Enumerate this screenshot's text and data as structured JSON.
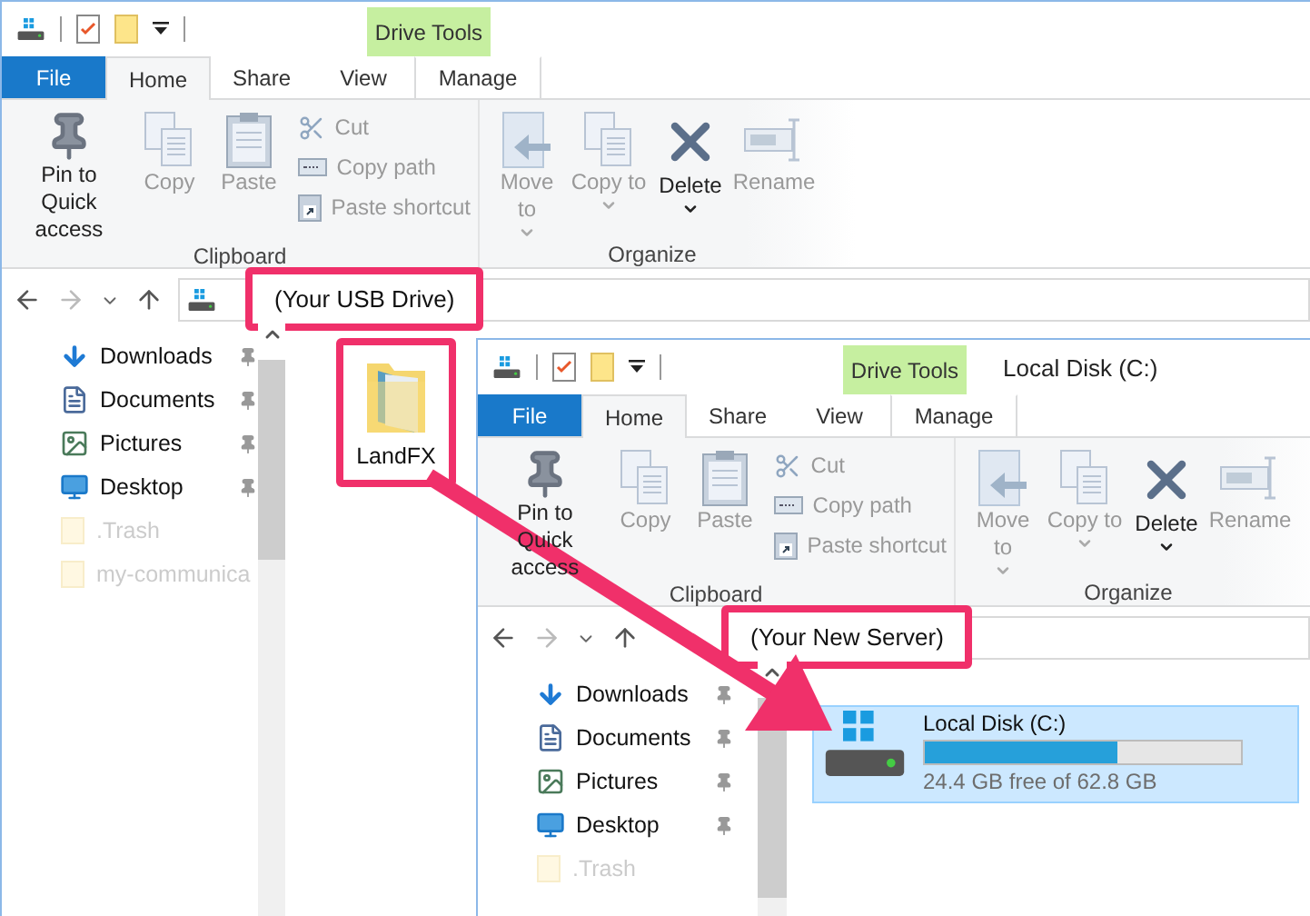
{
  "windows": [
    {
      "contextual_tab": "Drive Tools",
      "tabs": [
        {
          "label": "File",
          "kind": "file",
          "selected": false
        },
        {
          "label": "Home",
          "kind": "normal",
          "selected": true
        },
        {
          "label": "Share",
          "kind": "normal",
          "selected": false
        },
        {
          "label": "View",
          "kind": "normal",
          "selected": false
        },
        {
          "label": "Manage",
          "kind": "context",
          "selected": false
        }
      ],
      "ribbon_groups": [
        {
          "label": "Clipboard",
          "items": [
            {
              "label": "Pin to Quick access",
              "kind": "large",
              "disabled": false,
              "menu": false
            },
            {
              "label": "Copy",
              "kind": "large",
              "disabled": true,
              "menu": false
            },
            {
              "label": "Paste",
              "kind": "large",
              "disabled": true,
              "menu": false
            },
            {
              "label": "Cut",
              "kind": "small",
              "disabled": true
            },
            {
              "label": "Copy path",
              "kind": "small",
              "disabled": true
            },
            {
              "label": "Paste shortcut",
              "kind": "small",
              "disabled": true
            }
          ]
        },
        {
          "label": "Organize",
          "items": [
            {
              "label": "Move to",
              "kind": "large",
              "disabled": true,
              "menu": true
            },
            {
              "label": "Copy to",
              "kind": "large",
              "disabled": true,
              "menu": true
            },
            {
              "label": "Delete",
              "kind": "large",
              "disabled": false,
              "menu": true
            },
            {
              "label": "Rename",
              "kind": "large",
              "disabled": true,
              "menu": false
            }
          ]
        }
      ],
      "address": {
        "text": "(Your USB Drive)",
        "highlighted": true
      },
      "nav_items": [
        {
          "label": "Downloads",
          "pinned": true,
          "hidden": false
        },
        {
          "label": "Documents",
          "pinned": true,
          "hidden": false
        },
        {
          "label": "Pictures",
          "pinned": true,
          "hidden": false
        },
        {
          "label": "Desktop",
          "pinned": true,
          "hidden": false
        },
        {
          "label": ".Trash",
          "pinned": false,
          "hidden": true
        },
        {
          "label": "my-communica",
          "pinned": false,
          "hidden": true
        }
      ],
      "content": {
        "kind": "folder",
        "label": "LandFX",
        "highlighted": true
      }
    },
    {
      "title": "Local Disk (C:)",
      "contextual_tab": "Drive Tools",
      "tabs": [
        {
          "label": "File",
          "kind": "file",
          "selected": false
        },
        {
          "label": "Home",
          "kind": "normal",
          "selected": true
        },
        {
          "label": "Share",
          "kind": "normal",
          "selected": false
        },
        {
          "label": "View",
          "kind": "normal",
          "selected": false
        },
        {
          "label": "Manage",
          "kind": "context",
          "selected": false
        }
      ],
      "ribbon_groups": [
        {
          "label": "Clipboard",
          "items": [
            {
              "label": "Pin to Quick access",
              "kind": "large",
              "disabled": false,
              "menu": false
            },
            {
              "label": "Copy",
              "kind": "large",
              "disabled": true,
              "menu": false
            },
            {
              "label": "Paste",
              "kind": "large",
              "disabled": true,
              "menu": false
            },
            {
              "label": "Cut",
              "kind": "small",
              "disabled": true
            },
            {
              "label": "Copy path",
              "kind": "small",
              "disabled": true
            },
            {
              "label": "Paste shortcut",
              "kind": "small",
              "disabled": true
            }
          ]
        },
        {
          "label": "Organize",
          "items": [
            {
              "label": "Move to",
              "kind": "large",
              "disabled": true,
              "menu": true
            },
            {
              "label": "Copy to",
              "kind": "large",
              "disabled": true,
              "menu": true
            },
            {
              "label": "Delete",
              "kind": "large",
              "disabled": false,
              "menu": true
            },
            {
              "label": "Rename",
              "kind": "large",
              "disabled": true,
              "menu": false
            }
          ]
        }
      ],
      "address": {
        "text": "(Your New Server)",
        "highlighted": true
      },
      "nav_items": [
        {
          "label": "Downloads",
          "pinned": true,
          "hidden": false
        },
        {
          "label": "Documents",
          "pinned": true,
          "hidden": false
        },
        {
          "label": "Pictures",
          "pinned": true,
          "hidden": false
        },
        {
          "label": "Desktop",
          "pinned": true,
          "hidden": false
        },
        {
          "label": ".Trash",
          "pinned": false,
          "hidden": true
        }
      ],
      "content": {
        "kind": "drive",
        "label": "Local Disk (C:)",
        "level": 0.61,
        "reading": "24.4 GB free of 62.8 GB",
        "selected": true
      }
    }
  ]
}
